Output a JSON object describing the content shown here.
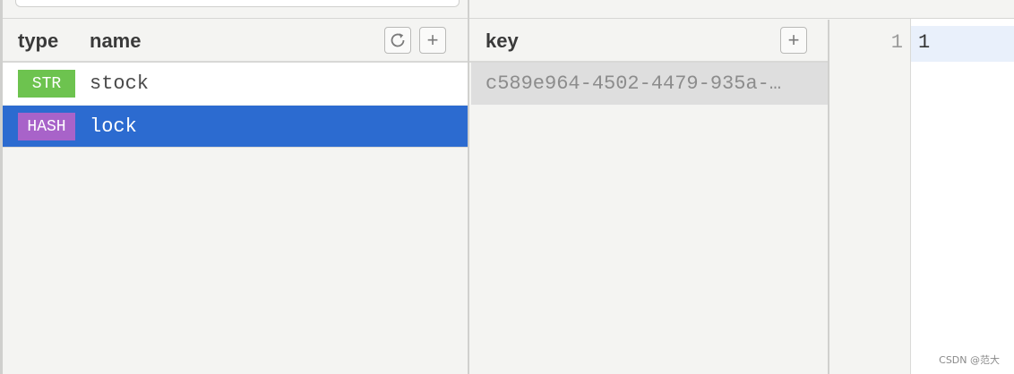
{
  "keys_panel": {
    "header": {
      "type_label": "type",
      "name_label": "name",
      "refresh_icon": "refresh-icon",
      "add_icon": "plus-icon",
      "add_symbol": "+"
    },
    "rows": [
      {
        "type": "STR",
        "name": "stock",
        "badge_color": "#6dc34f",
        "selected": false
      },
      {
        "type": "HASH",
        "name": "lock",
        "badge_color": "#a863c9",
        "selected": true
      }
    ],
    "selected_row_color": "#2c6bd0"
  },
  "fields_panel": {
    "header": {
      "key_label": "key",
      "add_icon": "plus-icon",
      "add_symbol": "+"
    },
    "fields": [
      {
        "key": "c589e964-4502-4479-935a-…"
      }
    ]
  },
  "value_editor": {
    "lines": [
      {
        "number": "1",
        "text": "1"
      }
    ]
  },
  "watermark": "CSDN @范大"
}
